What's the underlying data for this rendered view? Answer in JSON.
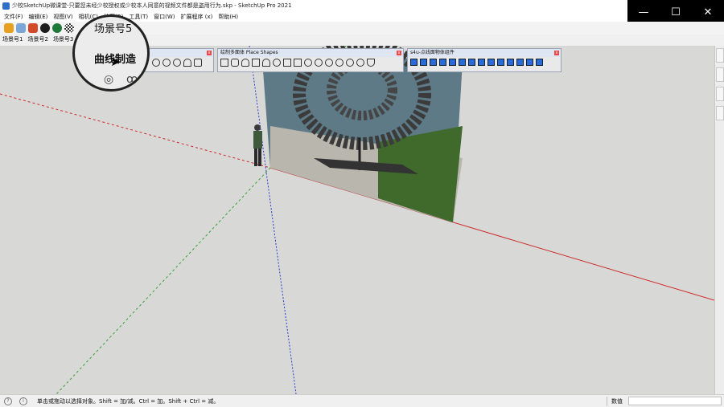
{
  "window": {
    "title": "少校SketchUp微课堂-只要您未经少校授权或少校本人同意的视频文件都是盗用行为.skp - SketchUp Pro 2021",
    "controls": {
      "minimize": "—",
      "maximize": "☐",
      "close": "✕"
    }
  },
  "menu": [
    {
      "label": "文件(F)"
    },
    {
      "label": "编辑(E)"
    },
    {
      "label": "视图(V)"
    },
    {
      "label": "相机(C)"
    },
    {
      "label": "绘图(R)"
    },
    {
      "label": "工具(T)"
    },
    {
      "label": "窗口(W)"
    },
    {
      "label": "扩展程序 (x)"
    },
    {
      "label": "帮助(H)"
    }
  ],
  "toolbar": {
    "icons": [
      {
        "name": "sketchup-logo-icon",
        "color": "#e8a020"
      },
      {
        "name": "refresh-icon",
        "color": "#7aa7d8"
      },
      {
        "name": "layers-icon",
        "color": "#d24a2a"
      },
      {
        "name": "add-circle-icon",
        "color": "#1d1d1d"
      },
      {
        "name": "warehouse-icon",
        "color": "#1f7a3a"
      },
      {
        "name": "checker-icon",
        "color": "#333333"
      }
    ]
  },
  "scenes": [
    {
      "label": "场景号1"
    },
    {
      "label": "场景号2"
    },
    {
      "label": "场景号3"
    }
  ],
  "magnifier": {
    "scene_label": "场景号5",
    "tooltip_label": "曲线制造",
    "swirl_left": "◎",
    "swirl_right": "ꝏ"
  },
  "panels": {
    "curve": {
      "title": ""
    },
    "place_shapes": {
      "title": "绘制多面体 Place Shapes"
    },
    "s4u": {
      "title": "s4u-点线面物体组件"
    }
  },
  "statusbar": {
    "hint": "单击或拖动以选择对象。Shift = 加/减。Ctrl = 加。Shift + Ctrl = 减。",
    "measure_label": "数值",
    "measure_value": ""
  },
  "colors": {
    "viewport_bg": "#d8d8d6",
    "red_axis": "#cc2b2b",
    "green_axis": "#3aa13a",
    "blue_axis": "#2a3bcc"
  }
}
